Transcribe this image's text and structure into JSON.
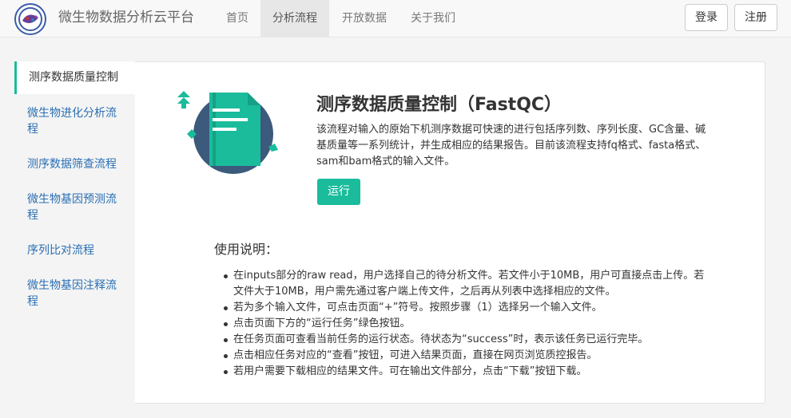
{
  "brand": "微生物数据分析云平台",
  "nav": {
    "links": [
      "首页",
      "分析流程",
      "开放数据",
      "关于我们"
    ],
    "login": "登录",
    "register": "注册"
  },
  "sidebar": {
    "items": [
      {
        "label": "测序数据质量控制"
      },
      {
        "label": "微生物进化分析流程"
      },
      {
        "label": "测序数据筛查流程"
      },
      {
        "label": "微生物基因预测流程"
      },
      {
        "label": "序列比对流程"
      },
      {
        "label": "微生物基因注释流程"
      }
    ]
  },
  "main": {
    "title": "测序数据质量控制（FastQC）",
    "description": "该流程对输入的原始下机测序数据可快速的进行包括序列数、序列长度、GC含量、碱基质量等一系列统计，并生成相应的结果报告。目前该流程支持fq格式、fasta格式、sam和bam格式的输入文件。",
    "run_label": "运行",
    "usage_title": "使用说明：",
    "usage_items": [
      "在inputs部分的raw read，用户选择自己的待分析文件。若文件小于10MB，用户可直接点击上传。若文件大于10MB，用户需先通过客户端上传文件，之后再从列表中选择相应的文件。",
      "若为多个输入文件，可点击页面“+”符号。按照步骤（1）选择另一个输入文件。",
      "点击页面下方的“运行任务”绿色按钮。",
      "在任务页面可查看当前任务的运行状态。待状态为“success”时，表示该任务已运行完毕。",
      "点击相应任务对应的“查看”按钮，可进入结果页面，直接在网页浏览质控报告。",
      "若用户需要下载相应的结果文件。可在输出文件部分，点击“下载”按钮下载。"
    ]
  },
  "colors": {
    "accent": "#1abc9c",
    "link": "#2a6fb3",
    "navbar_bg": "#f8f8f8",
    "active_nav_bg": "#e7e7e7",
    "illustration_circle": "#3b5a7c"
  }
}
